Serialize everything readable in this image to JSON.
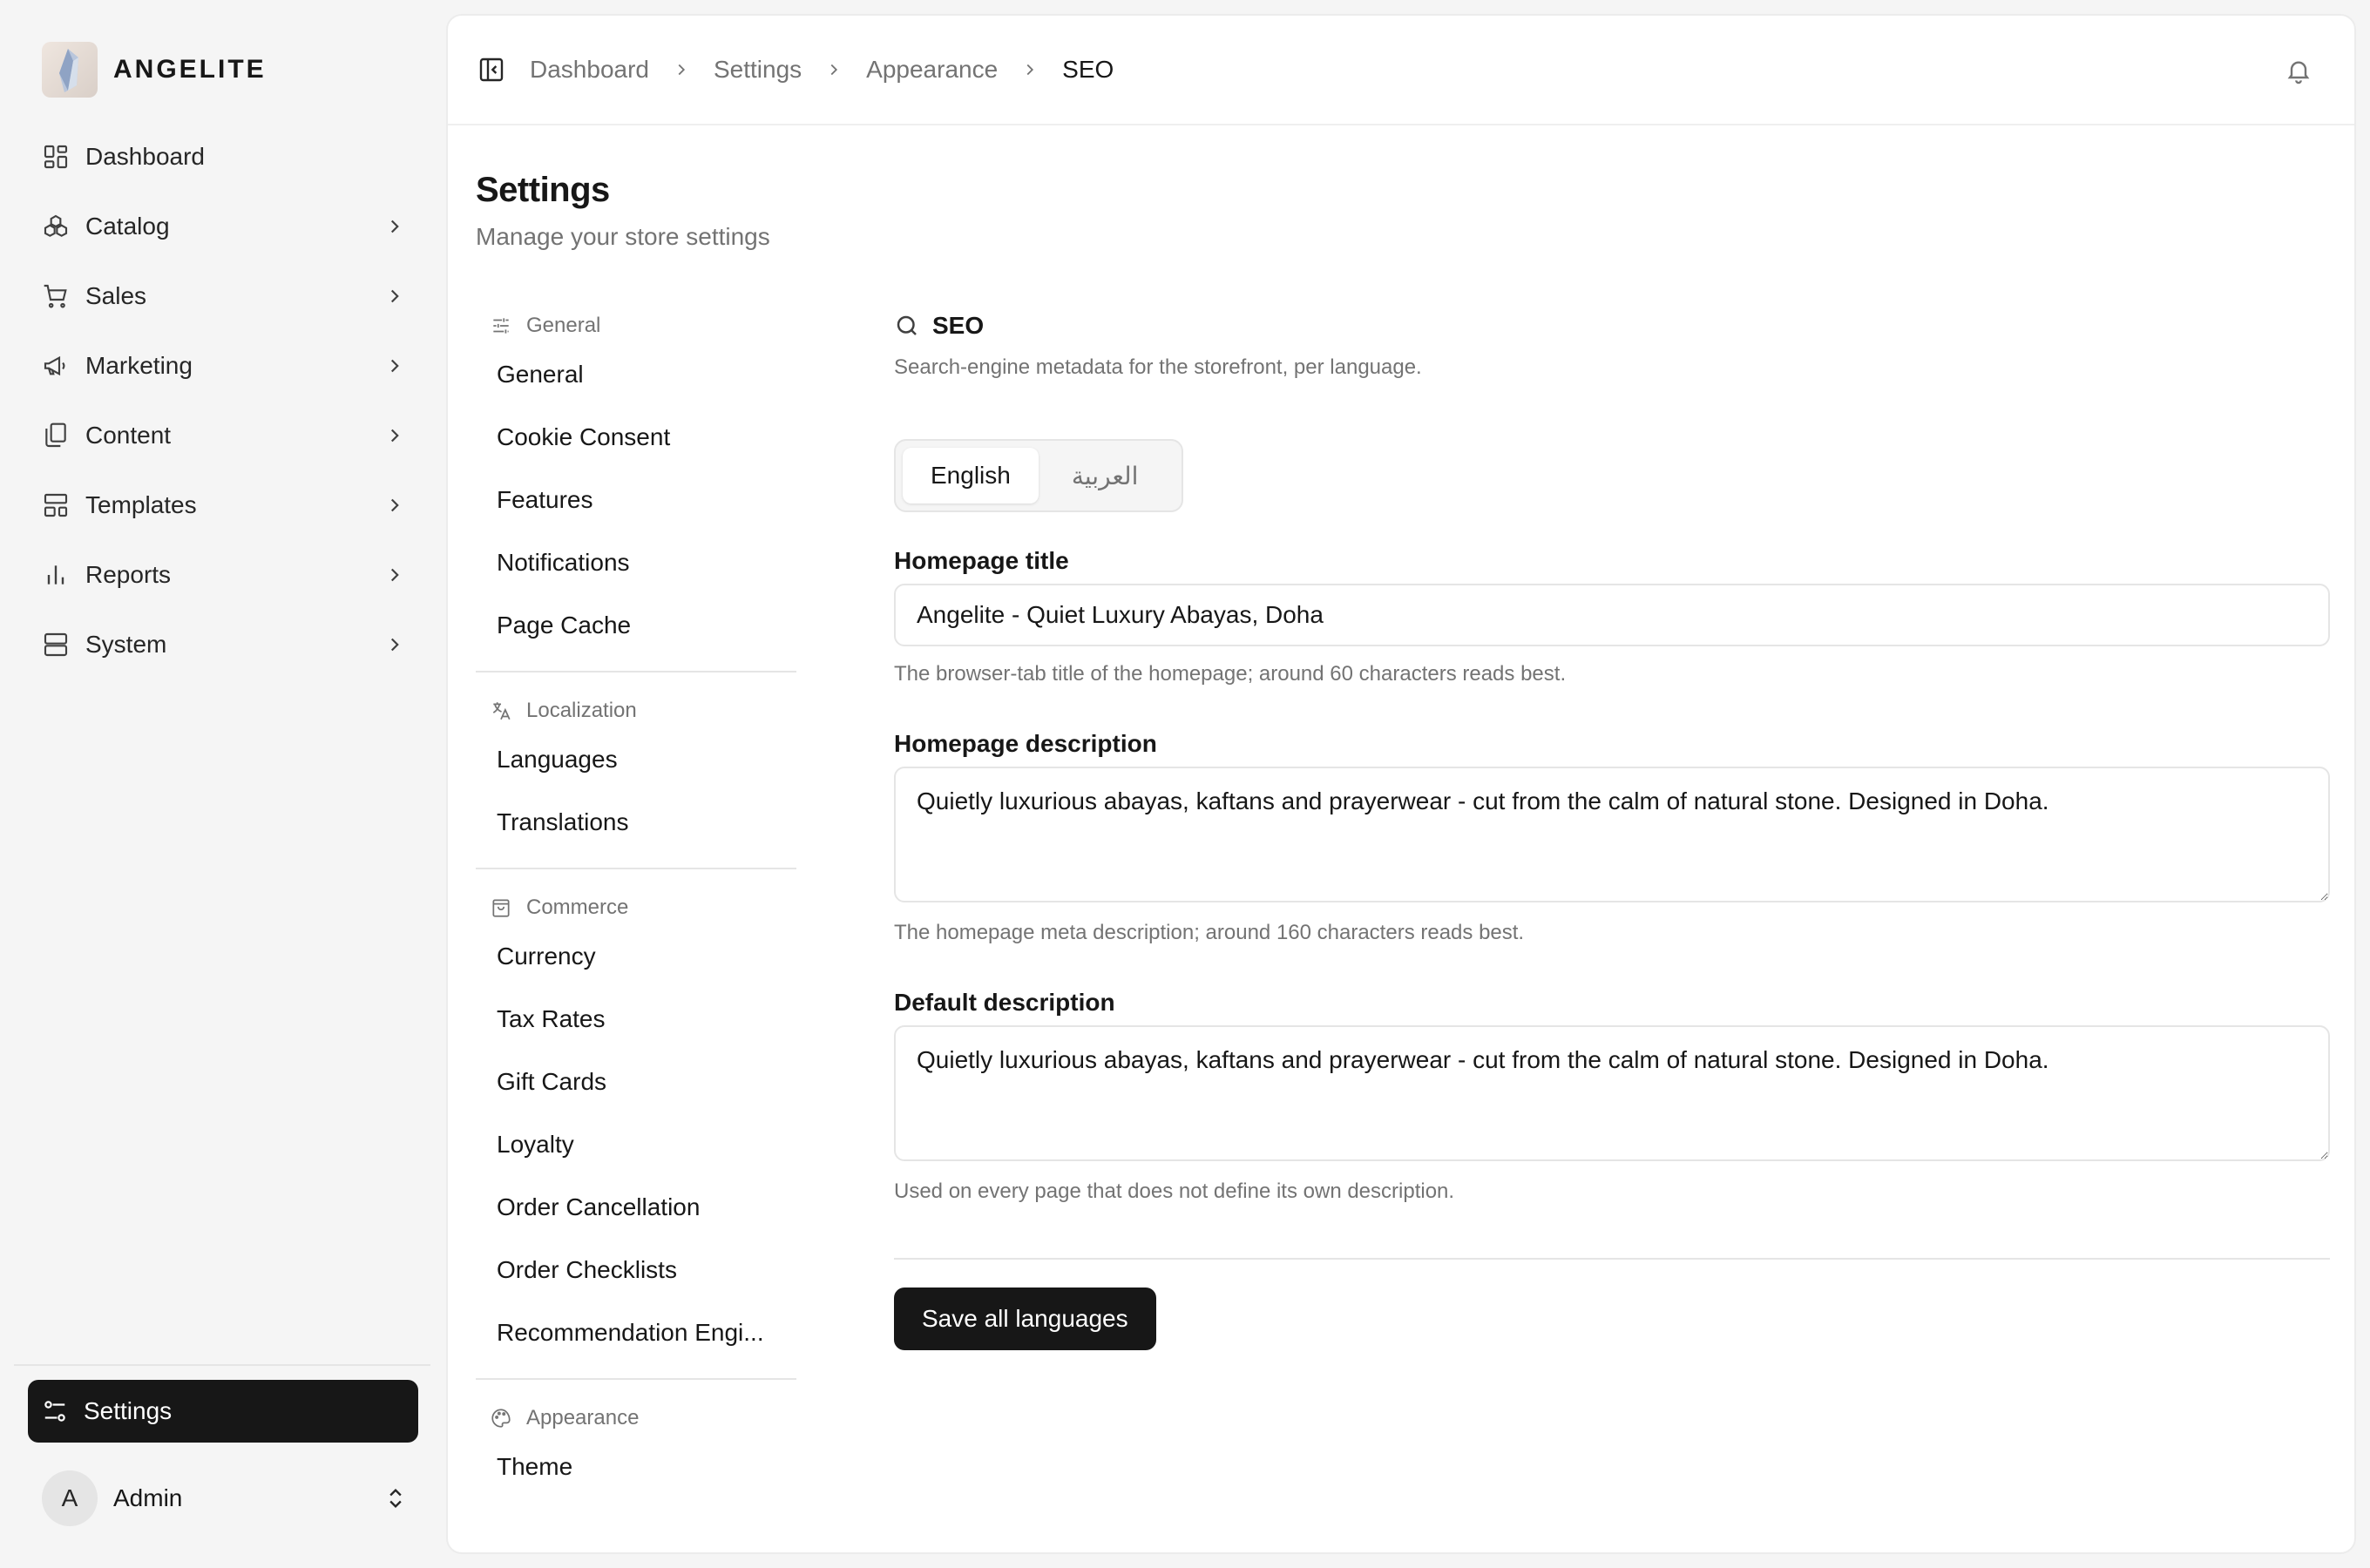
{
  "brand": {
    "name": "ANGELITE"
  },
  "sidebar": {
    "items": [
      {
        "label": "Dashboard",
        "icon": "dashboard-icon"
      },
      {
        "label": "Catalog",
        "icon": "catalog-icon"
      },
      {
        "label": "Sales",
        "icon": "cart-icon"
      },
      {
        "label": "Marketing",
        "icon": "megaphone-icon"
      },
      {
        "label": "Content",
        "icon": "files-icon"
      },
      {
        "label": "Templates",
        "icon": "layout-icon"
      },
      {
        "label": "Reports",
        "icon": "bar-chart-icon"
      },
      {
        "label": "System",
        "icon": "server-icon"
      }
    ],
    "settings_label": "Settings",
    "user": {
      "initial": "A",
      "name": "Admin"
    }
  },
  "breadcrumb": [
    "Dashboard",
    "Settings",
    "Appearance",
    "SEO"
  ],
  "page": {
    "title": "Settings",
    "subtitle": "Manage your store settings"
  },
  "subnav": {
    "groups": [
      {
        "label": "General",
        "items": [
          "General",
          "Cookie Consent",
          "Features",
          "Notifications",
          "Page Cache"
        ]
      },
      {
        "label": "Localization",
        "items": [
          "Languages",
          "Translations"
        ]
      },
      {
        "label": "Commerce",
        "items": [
          "Currency",
          "Tax Rates",
          "Gift Cards",
          "Loyalty",
          "Order Cancellation",
          "Order Checklists",
          "Recommendation Engi..."
        ]
      },
      {
        "label": "Appearance",
        "items": [
          "Theme"
        ]
      }
    ]
  },
  "seo": {
    "title": "SEO",
    "description": "Search-engine metadata for the storefront, per language.",
    "languages": [
      "English",
      "العربية"
    ],
    "active_language": "English",
    "homepage_title": {
      "label": "Homepage title",
      "value": "Angelite - Quiet Luxury Abayas, Doha",
      "hint": "The browser-tab title of the homepage; around 60 characters reads best."
    },
    "homepage_description": {
      "label": "Homepage description",
      "value": "Quietly luxurious abayas, kaftans and prayerwear - cut from the calm of natural stone. Designed in Doha.",
      "hint": "The homepage meta description; around 160 characters reads best."
    },
    "default_description": {
      "label": "Default description",
      "value": "Quietly luxurious abayas, kaftans and prayerwear - cut from the calm of natural stone. Designed in Doha.",
      "hint": "Used on every page that does not define its own description."
    },
    "save_label": "Save all languages"
  },
  "colors": {
    "accent": "#171717",
    "background": "#f5f5f5",
    "muted_text": "#737373",
    "border": "#e5e5e5"
  }
}
